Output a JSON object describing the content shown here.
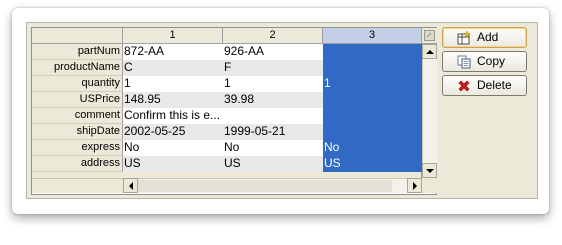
{
  "grid": {
    "columns": [
      "1",
      "2",
      "3"
    ],
    "selected_column_index": 2,
    "rows": [
      {
        "label": "partNum",
        "cells": [
          "872-AA",
          "926-AA",
          ""
        ]
      },
      {
        "label": "productName",
        "cells": [
          "C",
          "F",
          ""
        ]
      },
      {
        "label": "quantity",
        "cells": [
          "1",
          "1",
          "1"
        ]
      },
      {
        "label": "USPrice",
        "cells": [
          "148.95",
          "39.98",
          ""
        ]
      },
      {
        "label": "comment",
        "cells": [
          "Confirm this is e...",
          "",
          ""
        ]
      },
      {
        "label": "shipDate",
        "cells": [
          "2002-05-25",
          "1999-05-21",
          ""
        ]
      },
      {
        "label": "express",
        "cells": [
          "No",
          "No",
          "No"
        ]
      },
      {
        "label": "address",
        "cells": [
          "US",
          "US",
          "US"
        ]
      }
    ]
  },
  "buttons": {
    "add": {
      "label": "Add",
      "icon": "add-icon"
    },
    "copy": {
      "label": "Copy",
      "icon": "copy-icon"
    },
    "delete": {
      "label": "Delete",
      "icon": "delete-icon"
    }
  },
  "colors": {
    "selection": "#316ac5",
    "panel": "#ece9d8",
    "delete_icon": "#cc1b1b"
  }
}
